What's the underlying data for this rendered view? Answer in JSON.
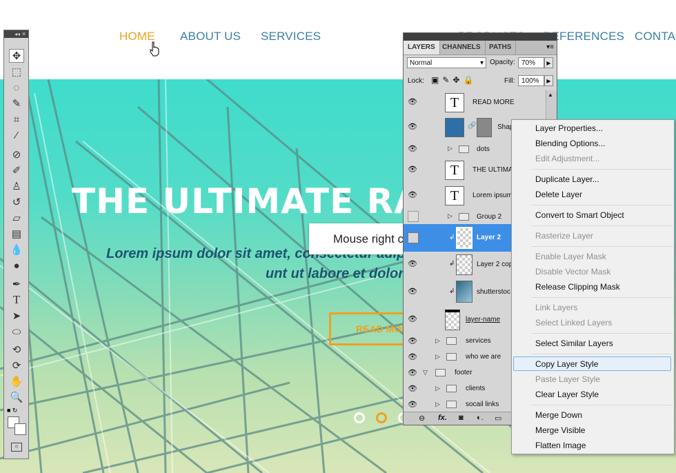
{
  "nav": {
    "items": [
      "HOME",
      "ABOUT US",
      "SERVICES",
      "PRODUCTS",
      "REFERENCES",
      "CONTAC"
    ],
    "active_color": "#f0a020",
    "color": "#3a7fa8"
  },
  "hero": {
    "title": "THE ULTIMATE RAIL",
    "subtitle_line1": "Lorem ipsum dolor sit amet, consectetur adipis",
    "subtitle_line2": "unt ut labore et dolore",
    "button": "READ MOR",
    "slider_dots": 3
  },
  "tooltip": "Mouse right click",
  "layers_panel": {
    "tabs": [
      "LAYERS",
      "CHANNELS",
      "PATHS"
    ],
    "blend_mode": "Normal",
    "opacity_label": "Opacity:",
    "opacity": "70%",
    "lock_label": "Lock:",
    "fill_label": "Fill:",
    "fill": "100%",
    "layers": [
      {
        "name": "READ MORE",
        "kind": "text"
      },
      {
        "name": "Shap",
        "kind": "shape"
      },
      {
        "name": "dots",
        "kind": "folder"
      },
      {
        "name": "THE ULTIMA",
        "kind": "text"
      },
      {
        "name": "Lorem ipsum",
        "kind": "text"
      },
      {
        "name": "Group 2",
        "kind": "folder"
      },
      {
        "name": "Layer 2",
        "kind": "layer",
        "selected": true
      },
      {
        "name": "Layer 2 cop",
        "kind": "layer"
      },
      {
        "name": "shutterstoc",
        "kind": "image"
      },
      {
        "name": "layer-name",
        "kind": "layer"
      },
      {
        "name": "services",
        "kind": "folder"
      },
      {
        "name": "who we are",
        "kind": "folder"
      },
      {
        "name": "footer",
        "kind": "folder"
      },
      {
        "name": "clients",
        "kind": "folder"
      },
      {
        "name": "socail links",
        "kind": "folder"
      }
    ],
    "bottom_icons": [
      "link-icon",
      "fx-icon",
      "mask-icon",
      "adjustment-icon",
      "folder-icon"
    ]
  },
  "context_menu": {
    "items": [
      {
        "label": "Layer Properties...",
        "disabled": false
      },
      {
        "label": "Blending Options...",
        "disabled": false
      },
      {
        "label": "Edit Adjustment...",
        "disabled": true
      },
      {
        "label": "Duplicate Layer...",
        "disabled": false
      },
      {
        "label": "Delete Layer",
        "disabled": false
      },
      {
        "label": "Convert to Smart Object",
        "disabled": false
      },
      {
        "label": "Rasterize Layer",
        "disabled": true
      },
      {
        "label": "Enable Layer Mask",
        "disabled": true
      },
      {
        "label": "Disable Vector Mask",
        "disabled": true
      },
      {
        "label": "Release Clipping Mask",
        "disabled": false
      },
      {
        "label": "Link Layers",
        "disabled": true
      },
      {
        "label": "Select Linked Layers",
        "disabled": true
      },
      {
        "label": "Select Similar Layers",
        "disabled": false
      },
      {
        "label": "Copy Layer Style",
        "disabled": false,
        "highlighted": true
      },
      {
        "label": "Paste Layer Style",
        "disabled": true
      },
      {
        "label": "Clear Layer Style",
        "disabled": false
      },
      {
        "label": "Merge Down",
        "disabled": false
      },
      {
        "label": "Merge Visible",
        "disabled": false
      },
      {
        "label": "Flatten Image",
        "disabled": false
      }
    ]
  },
  "tools": [
    "move-tool-icon",
    "marquee-tool-icon",
    "lasso-tool-icon",
    "quick-select-tool-icon",
    "crop-tool-icon",
    "eyedropper-tool-icon",
    "healing-brush-tool-icon",
    "brush-tool-icon",
    "clone-stamp-tool-icon",
    "history-brush-tool-icon",
    "eraser-tool-icon",
    "gradient-tool-icon",
    "blur-tool-icon",
    "dodge-tool-icon",
    "pen-tool-icon",
    "type-tool-icon",
    "path-select-tool-icon",
    "shape-tool-icon",
    "3d-rotate-tool-icon",
    "3d-orbit-tool-icon",
    "hand-tool-icon",
    "zoom-tool-icon"
  ]
}
